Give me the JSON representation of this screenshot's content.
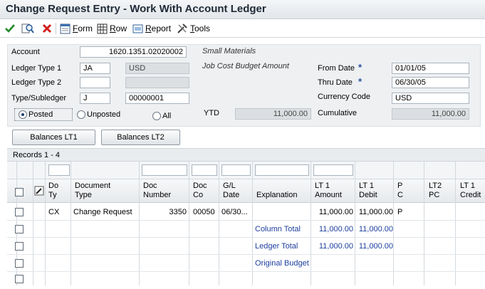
{
  "window": {
    "title": "Change Request Entry - Work With Account Ledger"
  },
  "toolbar": {
    "ok_icon": "checkmark-icon",
    "find_icon": "find-icon",
    "close_icon": "close-x-icon",
    "form_label": "Form",
    "form_hotkey": "F",
    "row_label": "Row",
    "row_hotkey": "R",
    "report_label": "Report",
    "report_hotkey": "R",
    "tools_label": "Tools",
    "tools_hotkey": "T"
  },
  "form": {
    "account_label": "Account",
    "account_value": "1620.1351.02020002",
    "account_desc": "Small Materials",
    "ledger_type1_label": "Ledger Type 1",
    "ledger_type1_value": "JA",
    "ledger_type1_currency": "USD",
    "ledger_type2_label": "Ledger Type 2",
    "ledger_type2_value": "",
    "ledger_type2_desc": "",
    "ledger_type1_desc": "Job Cost Budget Amount",
    "type_subledger_label": "Type/Subledger",
    "type_value": "J",
    "subledger_value": "00000001",
    "from_date_label": "From Date",
    "from_date_value": "01/01/05",
    "thru_date_label": "Thru Date",
    "thru_date_value": "06/30/05",
    "required_marker": "*",
    "currency_code_label": "Currency Code",
    "currency_code_value": "USD",
    "ytd_label": "YTD",
    "ytd_value": "11,000.00",
    "cumulative_label": "Cumulative",
    "cumulative_value": "11,000.00",
    "radio_posted": "Posted",
    "radio_unposted": "Unposted",
    "radio_all": "All",
    "selected_radio": "Posted"
  },
  "buttons": {
    "balances_lt1": "Balances LT1",
    "balances_lt2": "Balances LT2"
  },
  "grid": {
    "records_label": "Records 1 - 4",
    "columns": [
      {
        "h1": "Do",
        "h2": "Ty"
      },
      {
        "h1": "Document",
        "h2": "Type"
      },
      {
        "h1": "Doc",
        "h2": "Number"
      },
      {
        "h1": "Doc",
        "h2": "Co"
      },
      {
        "h1": "G/L",
        "h2": "Date"
      },
      {
        "h1": "Explanation",
        "h2": ""
      },
      {
        "h1": "LT 1",
        "h2": "Amount"
      },
      {
        "h1": "LT 1",
        "h2": "Debit"
      },
      {
        "h1": "P",
        "h2": "C"
      },
      {
        "h1": "LT2",
        "h2": "PC"
      },
      {
        "h1": "LT 1",
        "h2": "Credit"
      }
    ],
    "rows": [
      {
        "do_ty": "CX",
        "doc_type": "Change Request",
        "doc_number": "3350",
        "doc_co": "00050",
        "gl_date": "06/30...",
        "explanation": "",
        "lt1_amount": "11,000.00",
        "lt1_debit": "11,000.00",
        "pc": "P",
        "lt2_pc": "",
        "lt1_credit": ""
      },
      {
        "do_ty": "",
        "doc_type": "",
        "doc_number": "",
        "doc_co": "",
        "gl_date": "",
        "explanation": "Column Total",
        "lt1_amount": "11,000.00",
        "lt1_debit": "11,000.00",
        "pc": "",
        "lt2_pc": "",
        "lt1_credit": ""
      },
      {
        "do_ty": "",
        "doc_type": "",
        "doc_number": "",
        "doc_co": "",
        "gl_date": "",
        "explanation": "Ledger Total",
        "lt1_amount": "11,000.00",
        "lt1_debit": "11,000.00",
        "pc": "",
        "lt2_pc": "",
        "lt1_credit": ""
      },
      {
        "do_ty": "",
        "doc_type": "",
        "doc_number": "",
        "doc_co": "",
        "gl_date": "",
        "explanation": "Original Budget",
        "lt1_amount": "",
        "lt1_debit": "",
        "pc": "",
        "lt2_pc": "",
        "lt1_credit": ""
      }
    ]
  },
  "colors": {
    "link": "#1d3f9e",
    "required": "#2a4f9e",
    "header_bg": "#e6e9ec"
  }
}
